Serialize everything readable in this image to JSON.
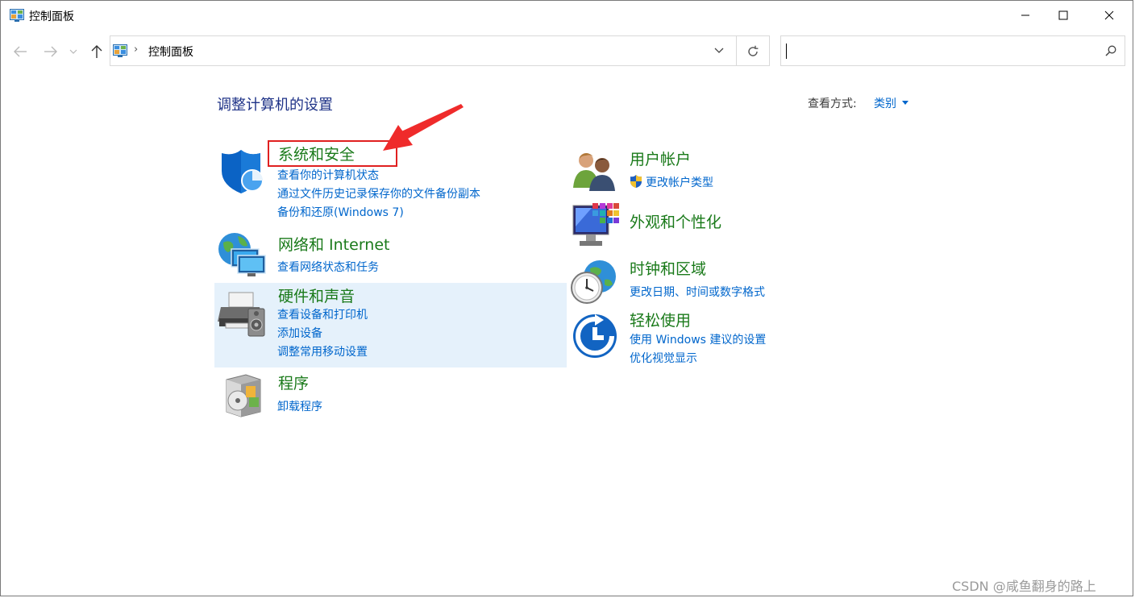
{
  "window": {
    "title": "控制面板"
  },
  "address": {
    "path": "控制面板",
    "separator": "›"
  },
  "search": {
    "placeholder": ""
  },
  "main": {
    "heading": "调整计算机的设置",
    "view_by_label": "查看方式:",
    "view_by_value": "类别"
  },
  "categories": {
    "system_security": {
      "title": "系统和安全",
      "links": [
        "查看你的计算机状态",
        "通过文件历史记录保存你的文件备份副本",
        "备份和还原(Windows 7)"
      ]
    },
    "network": {
      "title": "网络和 Internet",
      "links": [
        "查看网络状态和任务"
      ]
    },
    "hardware": {
      "title": "硬件和声音",
      "links": [
        "查看设备和打印机",
        "添加设备",
        "调整常用移动设置"
      ]
    },
    "programs": {
      "title": "程序",
      "links": [
        "卸载程序"
      ]
    },
    "user_accounts": {
      "title": "用户帐户",
      "links": [
        "更改帐户类型"
      ]
    },
    "appearance": {
      "title": "外观和个性化",
      "links": []
    },
    "clock_region": {
      "title": "时钟和区域",
      "links": [
        "更改日期、时间或数字格式"
      ]
    },
    "ease_of_access": {
      "title": "轻松使用",
      "links": [
        "使用 Windows 建议的设置",
        "优化视觉显示"
      ]
    }
  },
  "watermark": "CSDN @咸鱼翻身的路上",
  "colors": {
    "category_title": "#1a7a1a",
    "link": "#0066cc",
    "heading": "#1e3287",
    "highlight": "#e5f1fb",
    "annotation": "#e02020"
  }
}
